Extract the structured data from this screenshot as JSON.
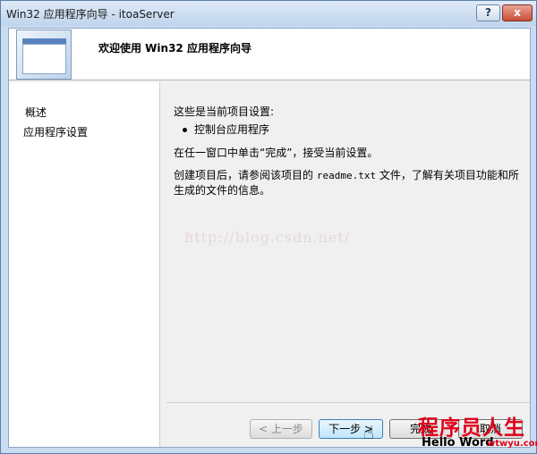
{
  "window": {
    "title": "Win32 应用程序向导 - itoaServer",
    "help_label": "?",
    "close_label": "x"
  },
  "banner": {
    "heading": "欢迎使用 Win32 应用程序向导",
    "icon": "wizard-window-icon"
  },
  "sidebar": {
    "items": [
      {
        "label": "概述"
      },
      {
        "label": "应用程序设置"
      }
    ]
  },
  "content": {
    "settings_title": "这些是当前项目设置:",
    "bullet_item": "控制台应用程序",
    "finish_instruction": "在任一窗口中单击“完成”，接受当前设置。",
    "readme_prefix": "创建项目后，请参阅该项目的",
    "readme_file": "readme.txt",
    "readme_suffix": "文件，了解有关项目功能和所生成的文件的信息。",
    "watermark": "http://blog.csdn.net/"
  },
  "buttons": {
    "prev": "< 上一步",
    "next": "下一步 >",
    "finish": "完成",
    "cancel": "取消"
  },
  "corner_watermark": {
    "big": "程序员人生",
    "small": "Hello Word",
    "url": "wtwyu.com"
  },
  "colors": {
    "accent": "#3c7fb1",
    "watermark_red": "#e0001b"
  }
}
